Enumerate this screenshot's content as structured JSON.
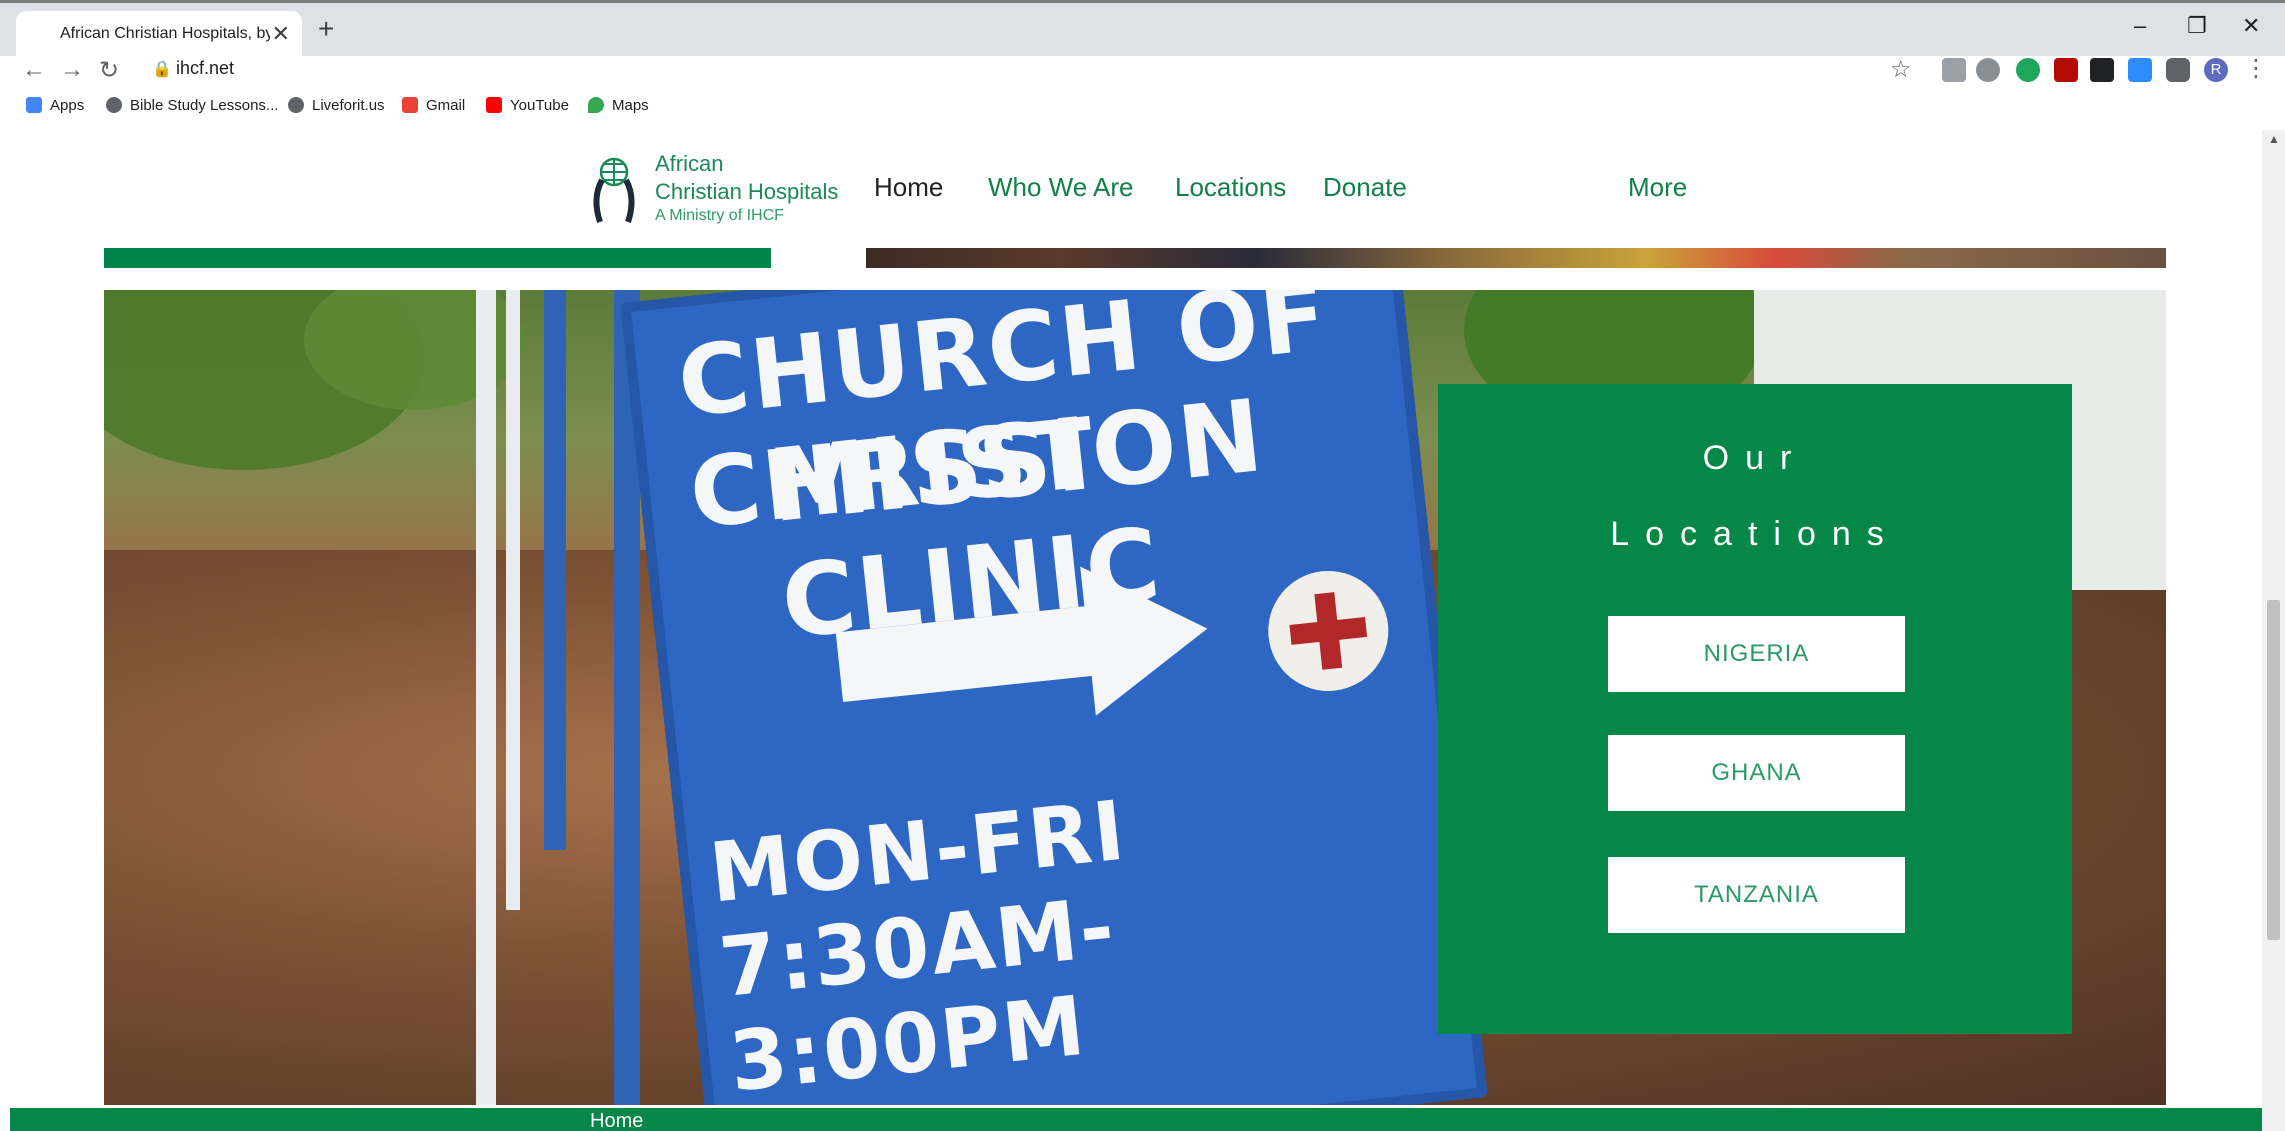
{
  "browser": {
    "tab_title": "African Christian Hospitals, by In",
    "tab_close": "✕",
    "new_tab": "+",
    "url": "ihcf.net",
    "window_controls": [
      "–",
      "❐",
      "✕"
    ],
    "bookmarks": [
      {
        "label": "Apps",
        "icon": "apps-grid-icon",
        "color": "#4285f4"
      },
      {
        "label": "Bible Study Lessons...",
        "icon": "globe-icon",
        "color": "#5f6368"
      },
      {
        "label": "Liveforit.us",
        "icon": "globe-icon",
        "color": "#5f6368"
      },
      {
        "label": "Gmail",
        "icon": "gmail-icon",
        "color": "#ea4335"
      },
      {
        "label": "YouTube",
        "icon": "youtube-icon",
        "color": "#ff0000"
      },
      {
        "label": "Maps",
        "icon": "maps-pin-icon",
        "color": "#34a853"
      }
    ],
    "profile_initial": "R"
  },
  "site": {
    "logo": {
      "line1": "African",
      "line2": "Christian Hospitals",
      "line3": "A Ministry of IHCF"
    },
    "nav": [
      {
        "label": "Home",
        "active": true
      },
      {
        "label": "Who We Are",
        "active": false
      },
      {
        "label": "Locations",
        "active": false
      },
      {
        "label": "Donate",
        "active": false
      },
      {
        "label": "More",
        "active": false
      }
    ],
    "locations_panel": {
      "title_line1": "Our",
      "title_line2": "Locations",
      "buttons": [
        "NIGERIA",
        "GHANA",
        "TANZANIA"
      ]
    },
    "sign": {
      "line1": "CHURCH OF CHRIST",
      "line2": "MISSION CLINIC",
      "line3": "MON-FRI 7:30AM-3:00PM"
    },
    "footer_label": "Home",
    "colors": {
      "brand_green": "#048747",
      "nav_green": "#128149"
    }
  }
}
